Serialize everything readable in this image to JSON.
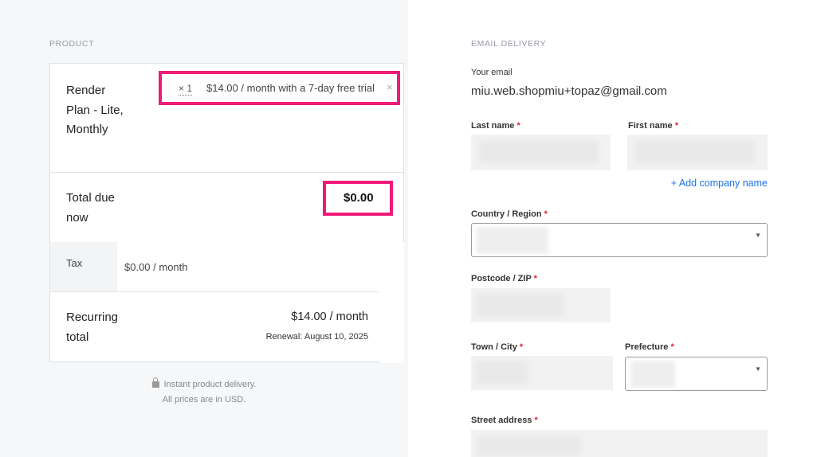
{
  "product_section": {
    "label": "PRODUCT",
    "product_name": "Render Plan - Lite, Monthly",
    "quantity": "× 1",
    "price_line": "$14.00 / month with a 7-day free trial",
    "remove_icon": "close-icon",
    "total_due_label": "Total due now",
    "total_due_amount": "$0.00",
    "tax_label": "Tax",
    "tax_value": "$0.00 / month",
    "recurring_label": "Recurring total",
    "recurring_amount": "$14.00 / month",
    "renewal": "Renewal: August 10, 2025",
    "footer_line1": "Instant product delivery.",
    "footer_line2": "All prices are in USD.",
    "lock_icon": "lock-icon"
  },
  "delivery_section": {
    "label": "EMAIL DELIVERY",
    "email_label": "Your email",
    "email_value": "miu.web.shopmiu+topaz@gmail.com",
    "last_name_label": "Last name",
    "first_name_label": "First name",
    "add_company": "+ Add company name",
    "country_label": "Country / Region",
    "postcode_label": "Postcode / ZIP",
    "town_label": "Town / City",
    "prefecture_label": "Prefecture",
    "street_label": "Street address",
    "required_marker": "*"
  },
  "colors": {
    "highlight": "#f01a7a",
    "link": "#1a73e8",
    "required": "#e0203a",
    "left_bg": "#f6f7f9"
  }
}
